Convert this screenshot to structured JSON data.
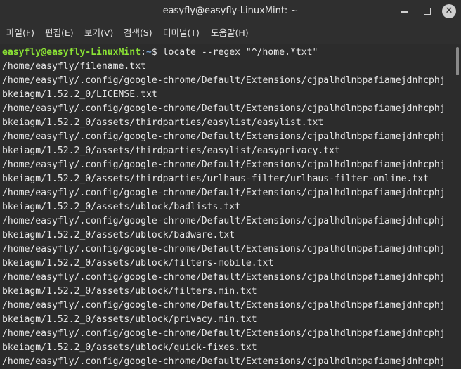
{
  "window": {
    "title": "easyfly@easyfly-LinuxMint: ~",
    "minimize_glyph": "",
    "maximize_glyph": "",
    "close_glyph": "✕"
  },
  "menu": {
    "items": [
      {
        "label": "파일(F)"
      },
      {
        "label": "편집(E)"
      },
      {
        "label": "보기(V)"
      },
      {
        "label": "검색(S)"
      },
      {
        "label": "터미널(T)"
      },
      {
        "label": "도움말(H)"
      }
    ]
  },
  "terminal": {
    "prompt": {
      "user_host": "easyfly@easyfly-LinuxMint",
      "separator": ":",
      "path": "~",
      "symbol": "$ ",
      "command": "locate --regex \"^/home.*txt\""
    },
    "lines": [
      "/home/easyfly/filename.txt",
      "/home/easyfly/.config/google-chrome/Default/Extensions/cjpalhdlnbpafiamejdnhcphj",
      "bkeiagm/1.52.2_0/LICENSE.txt",
      "/home/easyfly/.config/google-chrome/Default/Extensions/cjpalhdlnbpafiamejdnhcphj",
      "bkeiagm/1.52.2_0/assets/thirdparties/easylist/easylist.txt",
      "/home/easyfly/.config/google-chrome/Default/Extensions/cjpalhdlnbpafiamejdnhcphj",
      "bkeiagm/1.52.2_0/assets/thirdparties/easylist/easyprivacy.txt",
      "/home/easyfly/.config/google-chrome/Default/Extensions/cjpalhdlnbpafiamejdnhcphj",
      "bkeiagm/1.52.2_0/assets/thirdparties/urlhaus-filter/urlhaus-filter-online.txt",
      "/home/easyfly/.config/google-chrome/Default/Extensions/cjpalhdlnbpafiamejdnhcphj",
      "bkeiagm/1.52.2_0/assets/ublock/badlists.txt",
      "/home/easyfly/.config/google-chrome/Default/Extensions/cjpalhdlnbpafiamejdnhcphj",
      "bkeiagm/1.52.2_0/assets/ublock/badware.txt",
      "/home/easyfly/.config/google-chrome/Default/Extensions/cjpalhdlnbpafiamejdnhcphj",
      "bkeiagm/1.52.2_0/assets/ublock/filters-mobile.txt",
      "/home/easyfly/.config/google-chrome/Default/Extensions/cjpalhdlnbpafiamejdnhcphj",
      "bkeiagm/1.52.2_0/assets/ublock/filters.min.txt",
      "/home/easyfly/.config/google-chrome/Default/Extensions/cjpalhdlnbpafiamejdnhcphj",
      "bkeiagm/1.52.2_0/assets/ublock/privacy.min.txt",
      "/home/easyfly/.config/google-chrome/Default/Extensions/cjpalhdlnbpafiamejdnhcphj",
      "bkeiagm/1.52.2_0/assets/ublock/quick-fixes.txt",
      "/home/easyfly/.config/google-chrome/Default/Extensions/cjpalhdlnbpafiamejdnhcphj"
    ]
  },
  "colors": {
    "prompt_user": "#8ae234",
    "prompt_path": "#729fcf",
    "background": "#2c2c2c",
    "text": "#e7e7e7"
  }
}
